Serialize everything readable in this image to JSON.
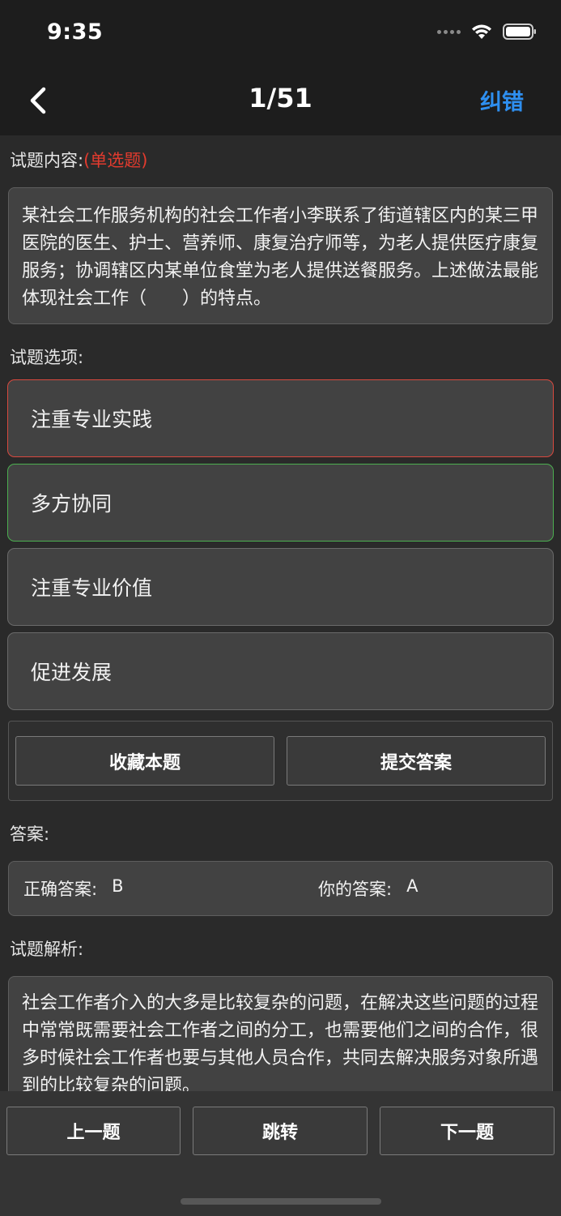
{
  "status": {
    "time": "9:35"
  },
  "nav": {
    "title": "1/51",
    "action": "纠错"
  },
  "question": {
    "content_label": "试题内容:",
    "type": "(单选题)",
    "text": "某社会工作服务机构的社会工作者小李联系了街道辖区内的某三甲医院的医生、护士、营养师、康复治疗师等，为老人提供医疗康复服务；协调辖区内某单位食堂为老人提供送餐服务。上述做法最能体现社会工作（　　）的特点。"
  },
  "options_label": "试题选项:",
  "options": [
    {
      "text": "注重专业实践",
      "state": "selected-wrong"
    },
    {
      "text": "多方协同",
      "state": "correct"
    },
    {
      "text": "注重专业价值",
      "state": "normal"
    },
    {
      "text": "促进发展",
      "state": "normal"
    }
  ],
  "actions": {
    "favorite": "收藏本题",
    "submit": "提交答案"
  },
  "answer": {
    "label": "答案:",
    "correct_label": "正确答案:",
    "correct_value": "B",
    "yours_label": "你的答案:",
    "yours_value": "A"
  },
  "analysis": {
    "label": "试题解析:",
    "text": "社会工作者介入的大多是比较复杂的问题，在解决这些问题的过程中常常既需要社会工作者之间的分工，也需要他们之间的合作，很多时候社会工作者也要与其他人员合作，共同去解决服务对象所遇到的比较复杂的问题。"
  },
  "footer": {
    "prev": "上一题",
    "jump": "跳转",
    "next": "下一题"
  },
  "colors": {
    "accent": "#2e8ff0",
    "wrong": "#d8493f",
    "correct": "#4caf50",
    "type_tag": "#e23b2e"
  }
}
